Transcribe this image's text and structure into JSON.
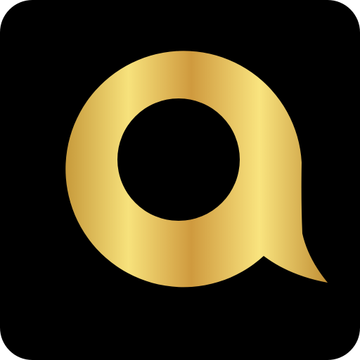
{
  "icon": {
    "name": "speech-bubble-logo",
    "background_color": "#000000",
    "gold_gradient": [
      "#c79a3b",
      "#f7e27c",
      "#cf9a3e",
      "#f9e47f",
      "#c18f35"
    ]
  }
}
